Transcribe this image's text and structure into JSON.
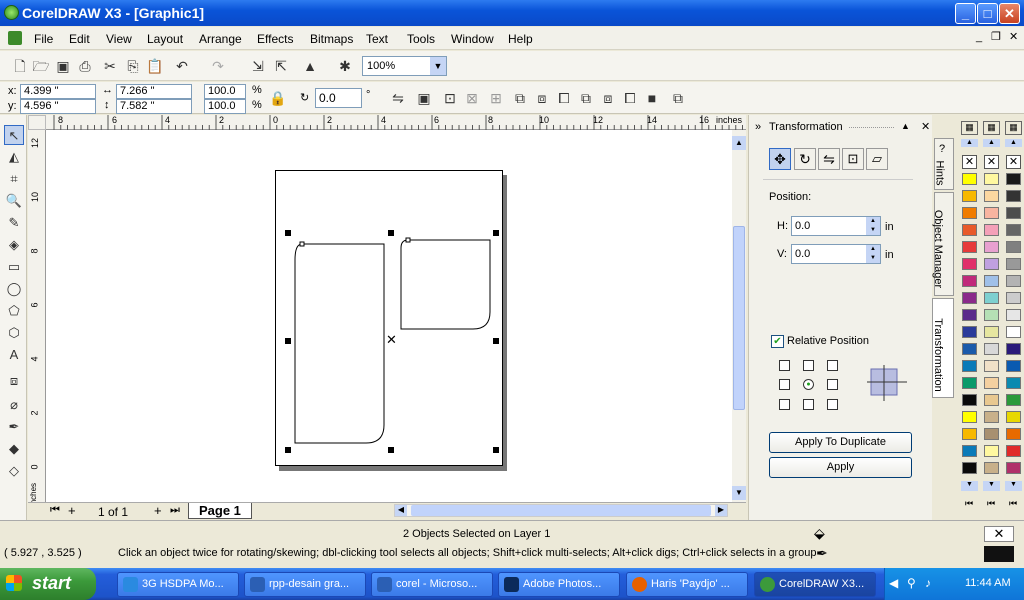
{
  "window": {
    "title": "CorelDRAW X3 - [Graphic1]",
    "controls": {
      "min": "_",
      "max": "□",
      "close": "✕"
    }
  },
  "menu": [
    "File",
    "Edit",
    "View",
    "Layout",
    "Arrange",
    "Effects",
    "Bitmaps",
    "Text",
    "Tools",
    "Window",
    "Help"
  ],
  "standard_toolbar": {
    "zoom_value": "100%"
  },
  "property_bar": {
    "x_label": "x:",
    "x_value": "4.399 \"",
    "y_label": "y:",
    "y_value": "4.596 \"",
    "width_value": "7.266 \"",
    "height_value": "7.582 \"",
    "scale_x": "100.0",
    "scale_y": "100.0",
    "percent": "%",
    "rotation_value": "0.0",
    "degree": "°"
  },
  "ruler": {
    "units": "inches",
    "h_ticks": [
      "8",
      "6",
      "4",
      "2",
      "0",
      "2",
      "4",
      "6",
      "8",
      "10",
      "12",
      "14",
      "16"
    ],
    "v_ticks": [
      "12",
      "10",
      "8",
      "6",
      "4",
      "2",
      "0"
    ],
    "v_units": "inches"
  },
  "page_nav": {
    "page_count": "1 of 1",
    "page_tab": "Page 1"
  },
  "docker": {
    "title": "Transformation",
    "position_label": "Position:",
    "h_label": "H:",
    "h_value": "0.0",
    "h_unit": "in",
    "v_label": "V:",
    "v_value": "0.0",
    "v_unit": "in",
    "relative_position_label": "Relative Position",
    "relative_position_checked": true,
    "apply_duplicate_label": "Apply To Duplicate",
    "apply_label": "Apply"
  },
  "docker_tabs": [
    "Hints",
    "Object Manager",
    "Transformation"
  ],
  "status": {
    "selection_text": "2 Objects Selected on Layer 1",
    "cursor_coords": "( 5.927 , 3.525 )",
    "hint_text": "Click an object twice for rotating/skewing; dbl-clicking tool selects all objects; Shift+click multi-selects; Alt+click digs; Ctrl+click selects in a group"
  },
  "taskbar": {
    "start_label": "start",
    "tasks": [
      "3G HSDPA Mo...",
      "rpp-desain gra...",
      "corel - Microso...",
      "Adobe Photos...",
      "Haris 'Paydjo' ...",
      "CorelDRAW X3..."
    ],
    "clock": "11:44 AM"
  },
  "colors": {
    "title_blue": "#0a54d8",
    "palette1": [
      "#ffff00",
      "#f7b800",
      "#f07c00",
      "#e85a2a",
      "#e63a3a",
      "#e0306a",
      "#c02a7a",
      "#8a2a8a",
      "#5a2a8a",
      "#2a3a9a",
      "#1a5aaa",
      "#0a7ab8",
      "#0a9a6a",
      "#0a0a0a",
      "#ffff00",
      "#f7b800",
      "#0a7ab8",
      "#0a0a0a"
    ],
    "palette2": [
      "#fff8a0",
      "#fcd7a0",
      "#f8b4a0",
      "#f4a0b8",
      "#e8a0d0",
      "#c0a0e0",
      "#a0c0e8",
      "#7ed0d0",
      "#b5e0b5",
      "#e6e6a0",
      "#d8d8d8",
      "#f0e0c8",
      "#f4d0a0",
      "#e8c890",
      "#c8b08a",
      "#a89070",
      "#fff8a0",
      "#c8b08a"
    ],
    "palette3": [
      "#1a1a1a",
      "#333333",
      "#4d4d4d",
      "#666666",
      "#808080",
      "#999999",
      "#b3b3b3",
      "#cccccc",
      "#e6e6e6",
      "#ffffff",
      "#2a1a7a",
      "#0a5ab0",
      "#0a8ab0",
      "#2a9a3a",
      "#e8d800",
      "#e86a00",
      "#e02a2a",
      "#b0306a"
    ]
  }
}
